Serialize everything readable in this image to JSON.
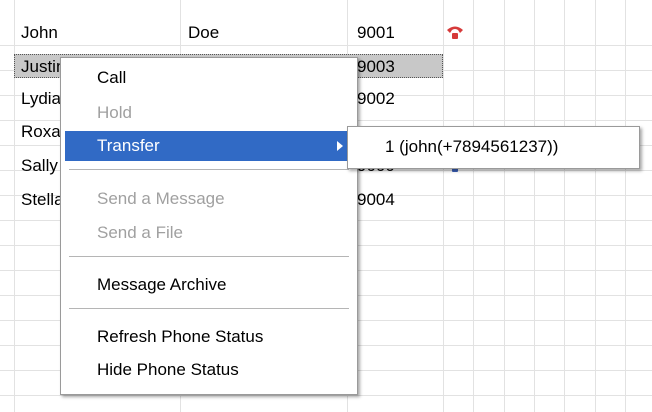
{
  "contacts": [
    {
      "first": "John",
      "last": "Doe",
      "ext": "9001",
      "status_icon": "phone-handset-icon",
      "status_color": "#d63a3a"
    },
    {
      "first": "Justin",
      "last": "",
      "ext": "9003",
      "selected": true
    },
    {
      "first": "Lydia",
      "last": "",
      "ext": "9002"
    },
    {
      "first": "Roxanne",
      "last": "",
      "ext": ""
    },
    {
      "first": "Sally",
      "last": "",
      "ext": "9000",
      "status_icon": "phone-handset-icon",
      "status_color": "#3a5fb8"
    },
    {
      "first": "Stella",
      "last": "",
      "ext": "9004"
    }
  ],
  "context_menu": {
    "items": [
      {
        "label": "Call",
        "enabled": true
      },
      {
        "label": "Hold",
        "enabled": false
      },
      {
        "label": "Transfer",
        "enabled": true,
        "highlighted": true,
        "has_submenu": true
      },
      {
        "label": "Send a Message",
        "enabled": false
      },
      {
        "label": "Send a File",
        "enabled": false
      },
      {
        "label": "Message Archive",
        "enabled": true
      },
      {
        "label": "Refresh Phone Status",
        "enabled": true
      },
      {
        "label": "Hide Phone Status",
        "enabled": true
      }
    ]
  },
  "transfer_submenu": {
    "items": [
      {
        "label": "1 (john(+7894561237))"
      }
    ]
  },
  "colors": {
    "highlight": "#316ac5",
    "selection": "#c8c8c8",
    "gridline": "#e2e2e2",
    "disabled_text": "#a0a0a0"
  }
}
